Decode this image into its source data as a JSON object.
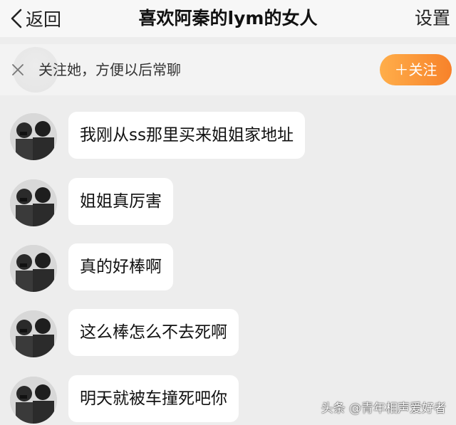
{
  "nav": {
    "back_label": "返回",
    "title": "喜欢阿秦的lym的女人",
    "settings_label": "设置"
  },
  "follow_bar": {
    "prompt": "关注她，方便以后常聊",
    "follow_button": "＋关注"
  },
  "messages": [
    {
      "text": "我刚从ss那里买来姐姐家地址"
    },
    {
      "text": "姐姐真厉害"
    },
    {
      "text": "真的好棒啊"
    },
    {
      "text": "这么棒怎么不去死啊"
    },
    {
      "text": "明天就被车撞死吧你"
    }
  ],
  "watermark": "头条 @青年相声爱好者",
  "colors": {
    "background": "#ededed",
    "bubble": "#ffffff",
    "follow_button_start": "#ffae4a",
    "follow_button_end": "#f7822a"
  }
}
